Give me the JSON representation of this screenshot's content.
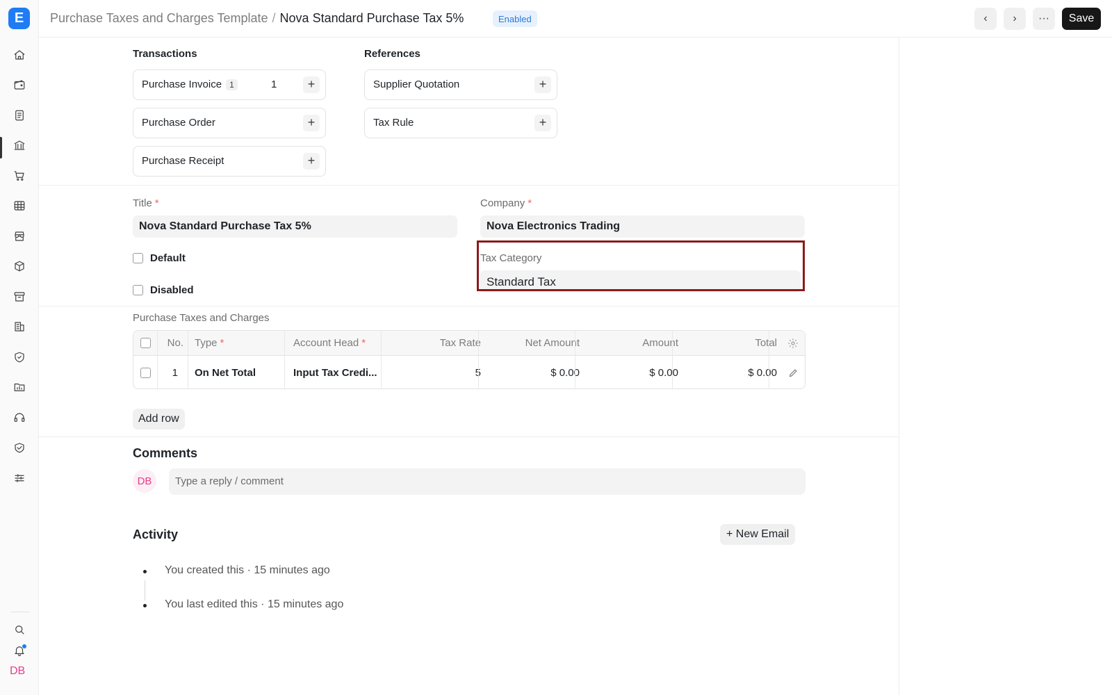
{
  "app": {
    "logo_letter": "E"
  },
  "header": {
    "breadcrumb_parent": "Purchase Taxes and Charges Template",
    "breadcrumb_separator": "/",
    "breadcrumb_current": "Nova Standard Purchase Tax 5%",
    "status_badge": "Enabled",
    "prev_icon": "‹",
    "next_icon": "›",
    "more_icon": "···",
    "save_label": "Save"
  },
  "connections": {
    "transactions_label": "Transactions",
    "references_label": "References",
    "transactions": [
      {
        "label": "Purchase Invoice",
        "count": "1",
        "number": "1"
      },
      {
        "label": "Purchase Order"
      },
      {
        "label": "Purchase Receipt"
      }
    ],
    "references": [
      {
        "label": "Supplier Quotation"
      },
      {
        "label": "Tax Rule"
      }
    ],
    "plus": "+"
  },
  "form": {
    "title_label": "Title",
    "title_value": "Nova Standard Purchase Tax 5%",
    "company_label": "Company",
    "company_value": "Nova Electronics Trading",
    "required_mark": "*",
    "default_label": "Default",
    "disabled_label": "Disabled",
    "tax_category_label": "Tax Category",
    "tax_category_value": "Standard Tax"
  },
  "taxes_table": {
    "section_label": "Purchase Taxes and Charges",
    "headers": {
      "no": "No.",
      "type": "Type",
      "account_head": "Account Head",
      "tax_rate": "Tax Rate",
      "net_amount": "Net Amount",
      "amount": "Amount",
      "total": "Total"
    },
    "rows": [
      {
        "no": "1",
        "type": "On Net Total",
        "account_head": "Input Tax Credi...",
        "tax_rate": "5",
        "net_amount": "$ 0.00",
        "amount": "$ 0.00",
        "total": "$ 0.00"
      }
    ],
    "add_row_label": "Add row"
  },
  "comments": {
    "title": "Comments",
    "avatar_initials": "DB",
    "placeholder": "Type a reply / comment"
  },
  "activity": {
    "title": "Activity",
    "new_email_label": "+ New Email",
    "items": [
      "You created this · 15 minutes ago",
      "You last edited this · 15 minutes ago"
    ]
  },
  "user": {
    "initials": "DB"
  },
  "colors": {
    "accent": "#1f7cf4",
    "highlight_border": "#8b1a1a",
    "badge_bg": "#e6f1fd",
    "avatar": "#e83e8c"
  },
  "sidebar_icons": [
    "home-icon",
    "wallet-icon",
    "document-icon",
    "bank-icon",
    "cart-icon",
    "table-icon",
    "store-icon",
    "package-icon",
    "archive-icon",
    "building-icon",
    "shield-icon",
    "folder-chart-icon",
    "headset-icon",
    "handshake-icon",
    "sliders-icon",
    "search-icon",
    "bell-icon"
  ]
}
